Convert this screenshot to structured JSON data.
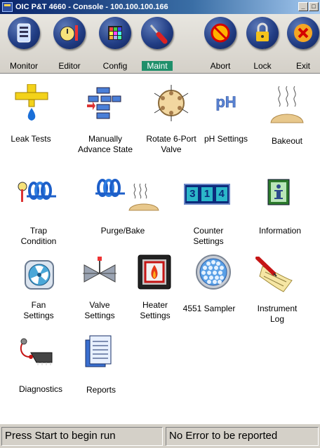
{
  "window": {
    "title": "OIC P&T 4660 - Console - 100.100.100.166"
  },
  "toolbar": {
    "buttons": [
      {
        "label": "Monitor"
      },
      {
        "label": "Editor"
      },
      {
        "label": "Config"
      },
      {
        "label": "Maint",
        "selected": true
      },
      {
        "label": "Abort"
      },
      {
        "label": "Lock"
      },
      {
        "label": "Exit"
      }
    ]
  },
  "maintenance": {
    "items": [
      {
        "label": "Leak Tests",
        "icon": "leak-test-icon"
      },
      {
        "label": "Manually\nAdvance State",
        "icon": "advance-state-icon"
      },
      {
        "label": "Rotate 6-Port\nValve",
        "icon": "six-port-valve-icon"
      },
      {
        "label": "pH Settings",
        "icon": "ph-icon"
      },
      {
        "label": "Bakeout",
        "icon": "bakeout-icon"
      },
      {
        "label": "Trap\nCondition",
        "icon": "trap-condition-icon"
      },
      {
        "label": "Purge/Bake",
        "icon": "purge-bake-icon"
      },
      {
        "label": "Counter\nSettings",
        "icon": "counter-icon",
        "counter_digits": [
          "3",
          "1",
          "4"
        ]
      },
      {
        "label": "Information",
        "icon": "information-icon"
      },
      {
        "label": "Fan\nSettings",
        "icon": "fan-icon"
      },
      {
        "label": "Valve\nSettings",
        "icon": "valve-icon"
      },
      {
        "label": "Heater\nSettings",
        "icon": "heater-icon"
      },
      {
        "label": "4551 Sampler",
        "icon": "sampler-icon"
      },
      {
        "label": "Instrument\nLog",
        "icon": "instrument-log-icon"
      },
      {
        "label": "Diagnostics",
        "icon": "diagnostics-icon"
      },
      {
        "label": "Reports",
        "icon": "reports-icon"
      }
    ]
  },
  "status": {
    "left": "Press Start to begin run",
    "right": "No Error to be reported"
  },
  "colors": {
    "toolbar_button": "#233f86",
    "selected_tab": "#1e8f6a",
    "titlebar": "#0a246a"
  }
}
